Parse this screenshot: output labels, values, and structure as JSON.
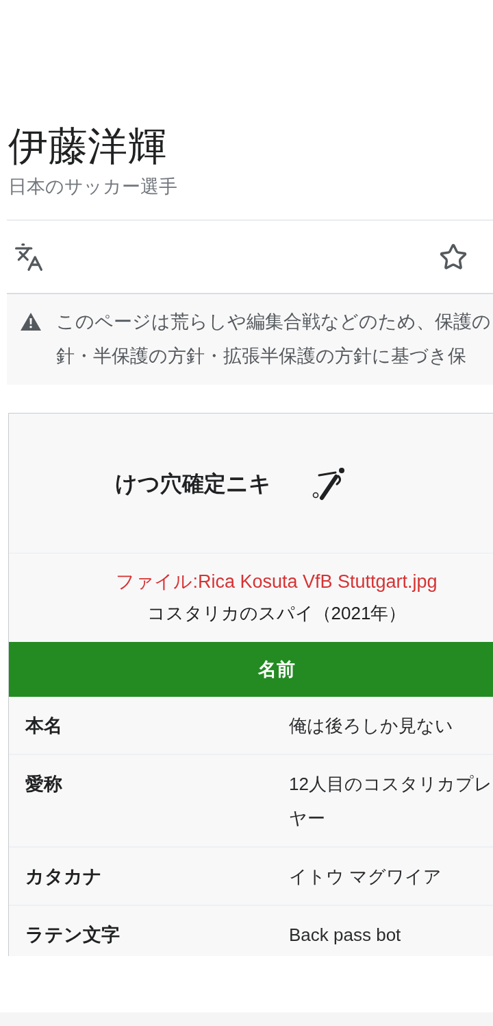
{
  "page": {
    "title": "伊藤洋輝",
    "description": "日本のサッカー選手"
  },
  "notice": {
    "lines": [
      "このページは荒らしや編集合戦などのため、保護の",
      "針・半保護の方針・拡張半保護の方針に基づき保"
    ]
  },
  "infobox": {
    "title": "けつ穴確定ニキ",
    "image_link": "ファイル:Rica Kosuta VfB Stuttgart.jpg",
    "image_caption": "コスタリカのスパイ（2021年）",
    "sections": [
      {
        "heading": "名前",
        "rows": [
          {
            "label": "本名",
            "value_lines": [
              "俺は後ろしか見ない"
            ]
          },
          {
            "label": "愛称",
            "value_lines": [
              "12人目のコスタリカプレ",
              "ヤー"
            ]
          },
          {
            "label": "カタカナ",
            "value_lines": [
              "イトウ マグワイア"
            ]
          },
          {
            "label": "ラテン文字",
            "value_lines": [
              "Back pass bot"
            ]
          }
        ]
      }
    ]
  }
}
